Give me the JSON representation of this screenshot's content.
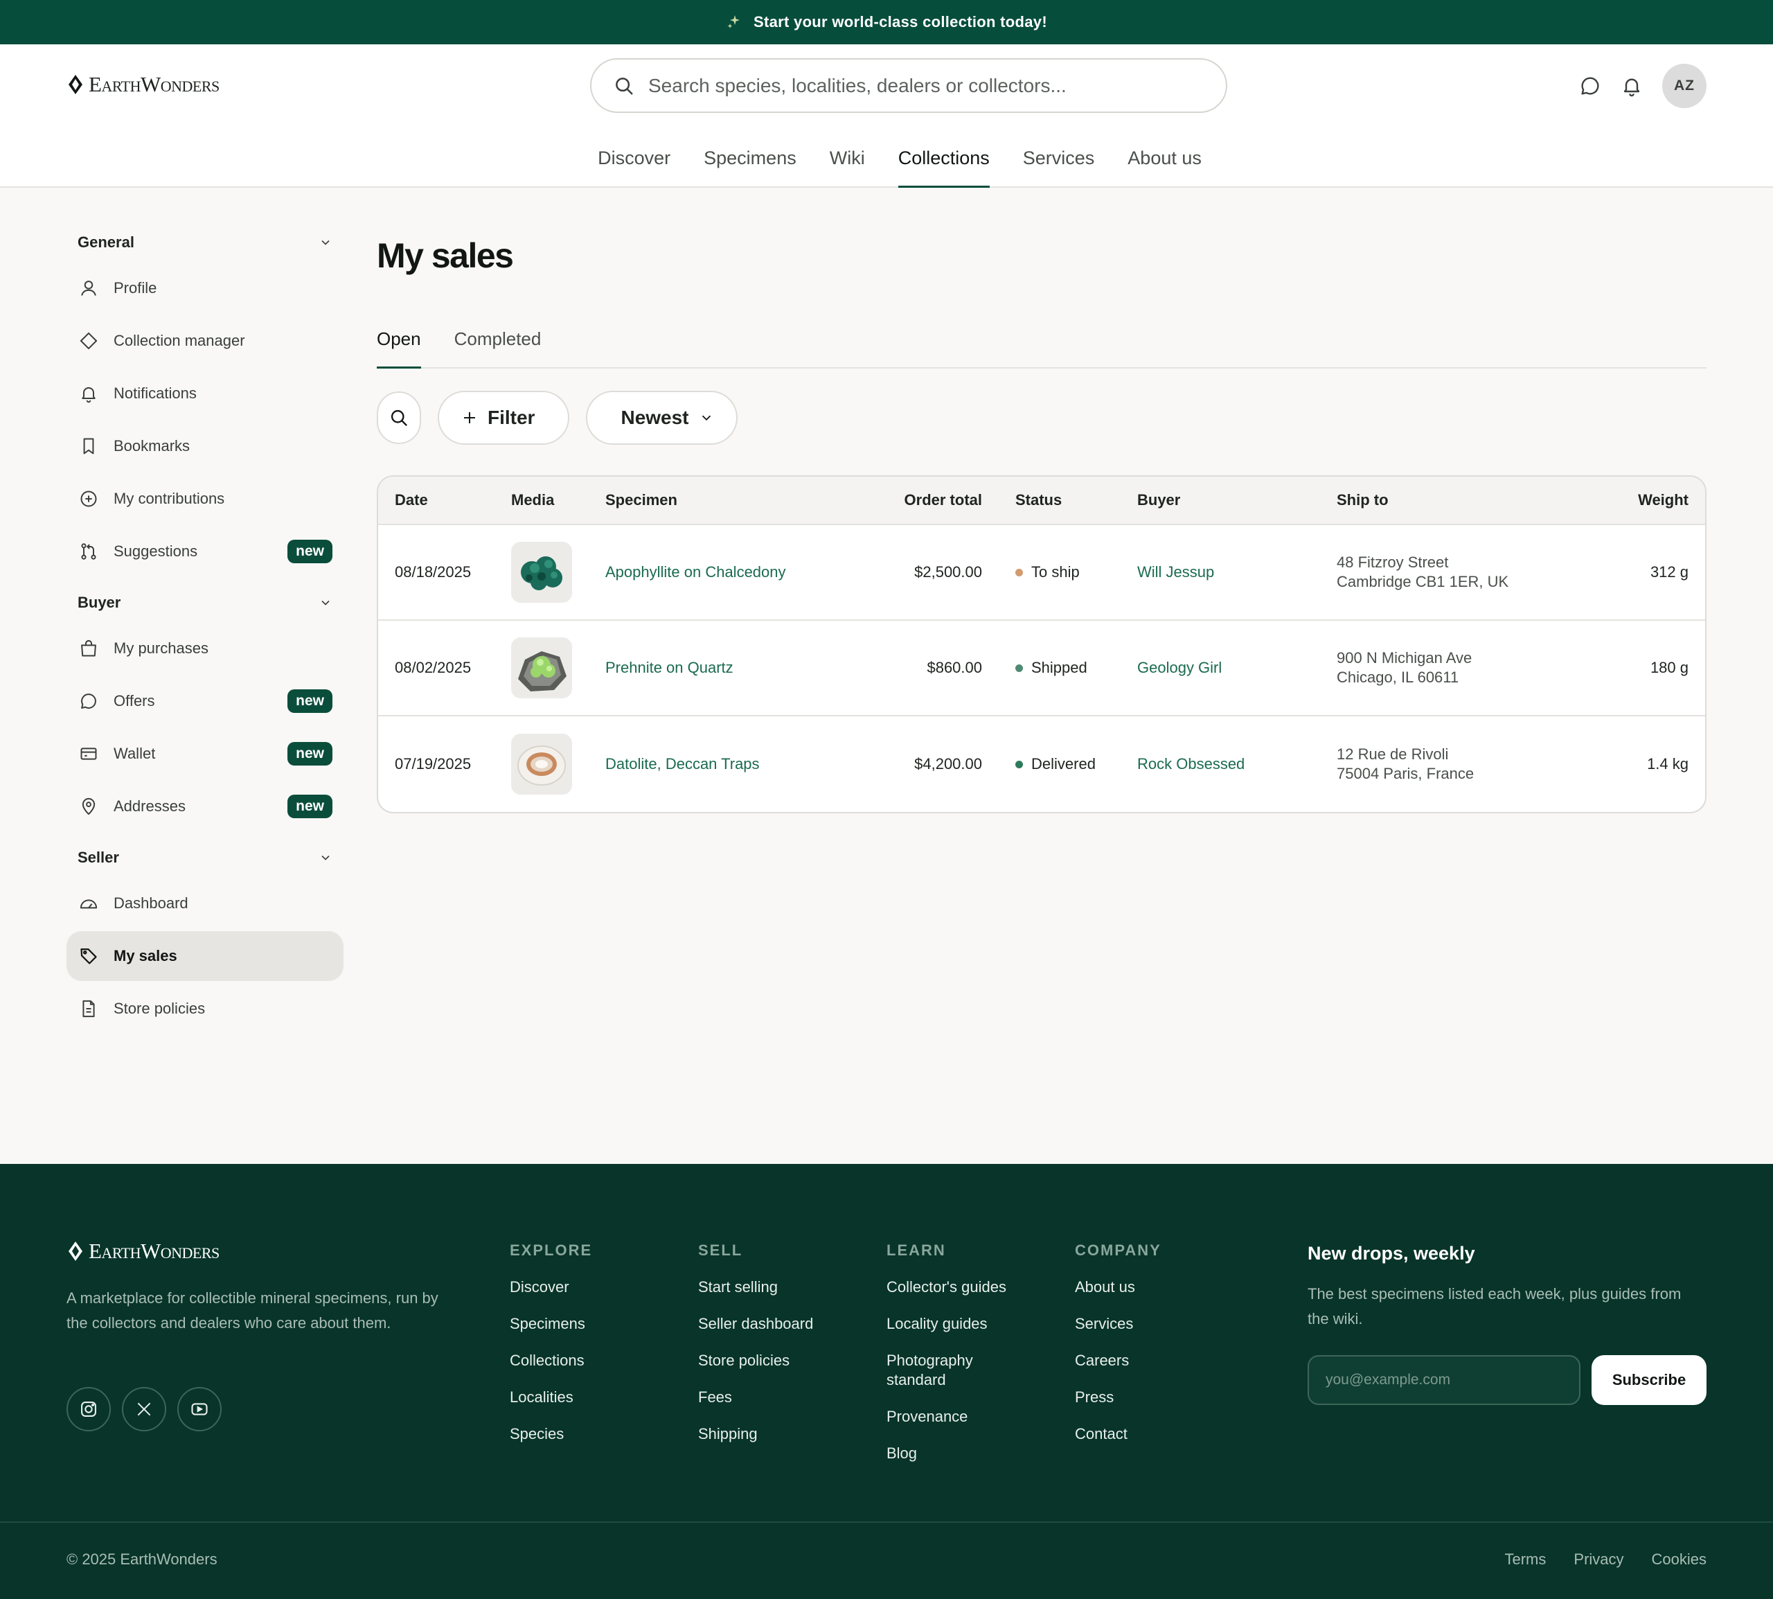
{
  "promo": {
    "text": "Start your world-class collection today!"
  },
  "header": {
    "logo": "EarthWonders",
    "search_placeholder": "Search species, localities, dealers or collectors...",
    "avatar_initials": "AZ",
    "nav": [
      "Discover",
      "Specimens",
      "Wiki",
      "Collections",
      "Services",
      "About us"
    ],
    "active_nav": "Collections"
  },
  "sidebar": {
    "sections": [
      {
        "title": "General",
        "items": [
          {
            "label": "Profile",
            "icon": "user-icon"
          },
          {
            "label": "Collection manager",
            "icon": "diamond-icon"
          },
          {
            "label": "Notifications",
            "icon": "bell-icon"
          },
          {
            "label": "Bookmarks",
            "icon": "bookmark-icon"
          },
          {
            "label": "My contributions",
            "icon": "plus-circle-icon"
          },
          {
            "label": "Suggestions",
            "icon": "git-pull-icon",
            "badge": "new"
          }
        ]
      },
      {
        "title": "Buyer",
        "items": [
          {
            "label": "My purchases",
            "icon": "shopping-bag-icon"
          },
          {
            "label": "Offers",
            "icon": "chat-bubble-icon",
            "badge": "new"
          },
          {
            "label": "Wallet",
            "icon": "wallet-icon",
            "badge": "new"
          },
          {
            "label": "Addresses",
            "icon": "map-pin-icon",
            "badge": "new"
          }
        ]
      },
      {
        "title": "Seller",
        "items": [
          {
            "label": "Dashboard",
            "icon": "gauge-icon"
          },
          {
            "label": "My sales",
            "icon": "tag-icon",
            "active": true
          },
          {
            "label": "Store policies",
            "icon": "document-icon"
          }
        ]
      }
    ]
  },
  "main": {
    "title": "My sales",
    "tabs": [
      "Open",
      "Completed"
    ],
    "active_tab": "Open",
    "filter_label": "Filter",
    "sort_label": "Newest",
    "columns": {
      "date": "Date",
      "media": "Media",
      "specimen": "Specimen",
      "total": "Order total",
      "status": "Status",
      "buyer": "Buyer",
      "ship": "Ship to",
      "weight": "Weight"
    },
    "rows": [
      {
        "date": "08/18/2025",
        "specimen": "Apophyllite on Chalcedony",
        "total": "$2,500.00",
        "status": "To ship",
        "status_color": "#d29a6e",
        "buyer": "Will Jessup",
        "ship1": "48 Fitzroy Street",
        "ship2": "Cambridge CB1 1ER, UK",
        "weight": "312 g"
      },
      {
        "date": "08/02/2025",
        "specimen": "Prehnite on Quartz",
        "total": "$860.00",
        "status": "Shipped",
        "status_color": "#4f8a74",
        "buyer": "Geology Girl",
        "ship1": "900 N Michigan Ave",
        "ship2": "Chicago, IL 60611",
        "weight": "180 g"
      },
      {
        "date": "07/19/2025",
        "specimen": "Datolite, Deccan Traps",
        "total": "$4,200.00",
        "status": "Delivered",
        "status_color": "#2e7a5c",
        "buyer": "Rock Obsessed",
        "ship1": "12 Rue de Rivoli",
        "ship2": "75004 Paris, France",
        "weight": "1.4 kg"
      }
    ]
  },
  "footer": {
    "logo": "EarthWonders",
    "tagline": "A marketplace for collectible mineral specimens, run by the collectors and dealers who care about them.",
    "columns": [
      {
        "title": "EXPLORE",
        "links": [
          "Discover",
          "Specimens",
          "Collections",
          "Localities",
          "Species"
        ]
      },
      {
        "title": "SELL",
        "links": [
          "Start selling",
          "Seller dashboard",
          "Store policies",
          "Fees",
          "Shipping"
        ]
      },
      {
        "title": "LEARN",
        "links": [
          "Collector's guides",
          "Locality guides",
          "Photography standard",
          "Provenance",
          "Blog"
        ]
      },
      {
        "title": "COMPANY",
        "links": [
          "About us",
          "Services",
          "Careers",
          "Press",
          "Contact"
        ]
      }
    ],
    "newsletter": {
      "title": "New drops, weekly",
      "text": "The best specimens listed each week, plus guides from the wiki.",
      "placeholder": "you@example.com",
      "button": "Subscribe"
    },
    "copyright": "© 2025 EarthWonders",
    "legal": [
      "Terms",
      "Privacy",
      "Cookies"
    ]
  }
}
